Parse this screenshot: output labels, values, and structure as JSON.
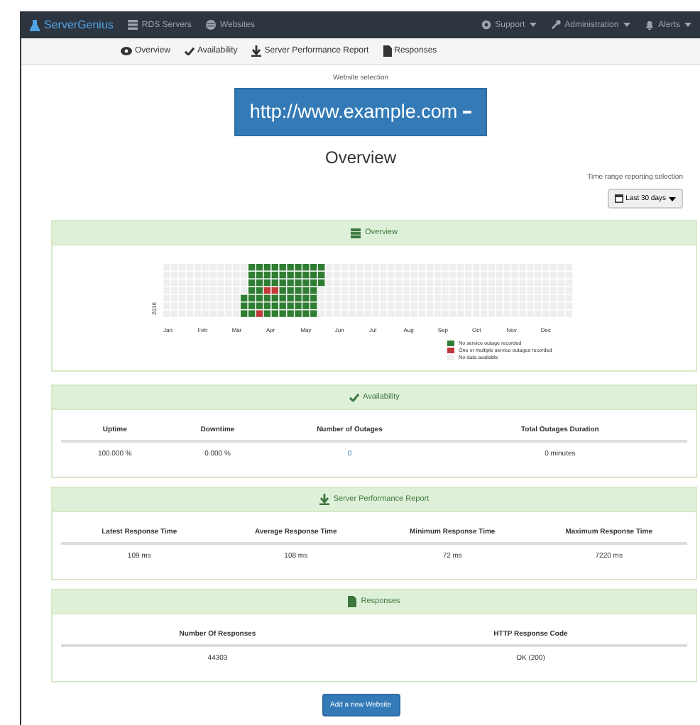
{
  "navbar": {
    "brand": "ServerGenius",
    "left_items": [
      {
        "label": "RDS Servers"
      },
      {
        "label": "Websites"
      }
    ],
    "right_items": [
      {
        "label": "Support"
      },
      {
        "label": "Administration"
      },
      {
        "label": "Alerts"
      }
    ]
  },
  "subnav": [
    {
      "label": "Overview"
    },
    {
      "label": "Availability"
    },
    {
      "label": "Server Performance Report"
    },
    {
      "label": "Responses"
    }
  ],
  "website_selection": {
    "label": "Website selection",
    "value": "http://www.example.com"
  },
  "heading": "Overview",
  "time_range": {
    "label": "Time range reporting selection",
    "value": "Last 30 days"
  },
  "overview_panel": {
    "title": "Overview",
    "year": "2016",
    "months": [
      "Jan",
      "Feb",
      "Mar",
      "Apr",
      "May",
      "Jun",
      "Jul",
      "Aug",
      "Sep",
      "Oct",
      "Nov",
      "Dec"
    ],
    "legend": [
      {
        "label": "No service outage recorded",
        "color": "#2f7d32"
      },
      {
        "label": "One or multiple service outages recorded",
        "color": "#c0393b"
      },
      {
        "label": "No data available",
        "color": "#eeeeee"
      }
    ]
  },
  "panels": [
    {
      "title": "Availability",
      "columns": [
        "Uptime",
        "Downtime",
        "Number of Outages",
        "Total Outages Duration"
      ],
      "row": [
        {
          "text": "100.000 %",
          "link": false
        },
        {
          "text": "0.000 %",
          "link": false
        },
        {
          "text": "0",
          "link": true
        },
        {
          "text": "0 minutes",
          "link": false
        }
      ]
    },
    {
      "title": "Server Performance Report",
      "columns": [
        "Latest Response Time",
        "Average Response Time",
        "Minimum Response Time",
        "Maximum Response Time"
      ],
      "row": [
        {
          "text": "109 ms",
          "link": false
        },
        {
          "text": "108 ms",
          "link": false
        },
        {
          "text": "72 ms",
          "link": false
        },
        {
          "text": "7220 ms",
          "link": false
        }
      ]
    },
    {
      "title": "Responses",
      "columns": [
        "Number Of Responses",
        "HTTP Response Code"
      ],
      "row": [
        {
          "text": "44303",
          "link": false
        },
        {
          "text": "OK (200)",
          "link": false
        }
      ]
    }
  ],
  "add_button": "Add a new Website"
}
